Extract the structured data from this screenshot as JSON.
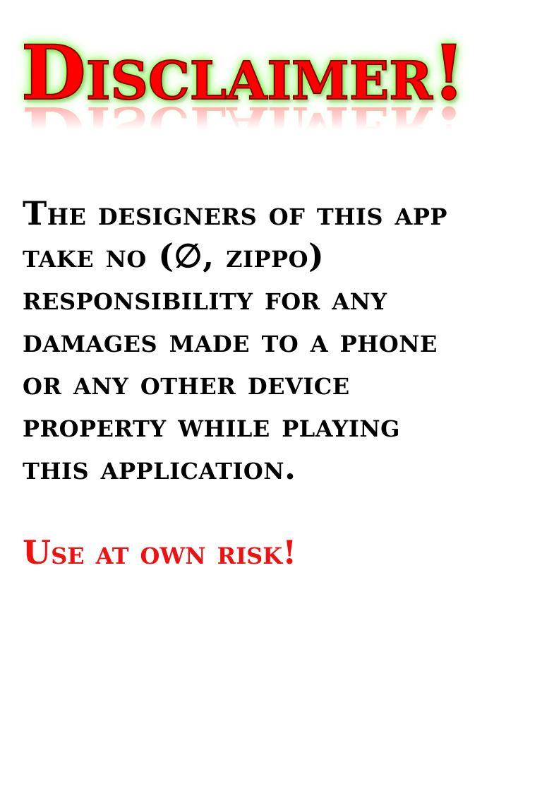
{
  "screen": {
    "title": "Disclaimer!",
    "body_lines": [
      "The designers of this app",
      "take no (∅, zippo)",
      "responsibility for any",
      "damages made to a phone",
      "or any other device",
      "property while playing",
      "this application."
    ],
    "warning": "Use at own risk!"
  },
  "colors": {
    "background": "#ffffff",
    "title_fill": "#ff0000",
    "title_glow": "#7dff4a",
    "body_text": "#000000",
    "warning_text": "#ee1111"
  }
}
